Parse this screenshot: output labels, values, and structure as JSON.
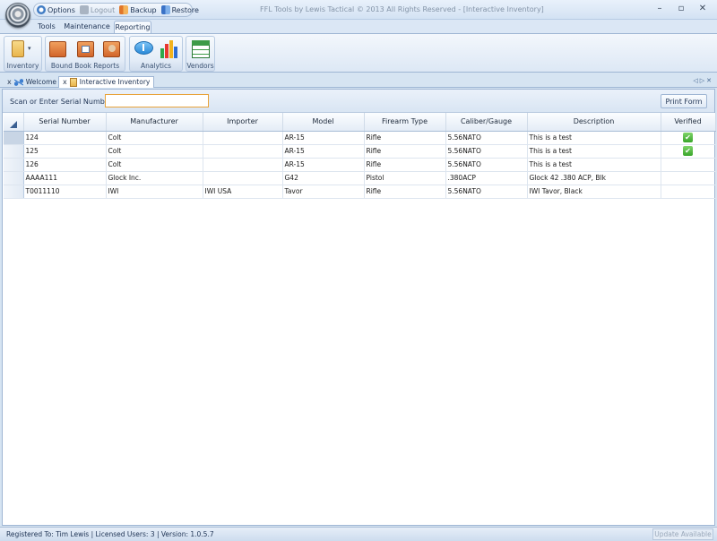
{
  "window": {
    "title": "FFL Tools by Lewis Tactical © 2013 All Rights Reserved - [Interactive Inventory]",
    "controls": {
      "minimize": "–",
      "maximize": "▫",
      "close": "✕"
    }
  },
  "quick_access": [
    {
      "label": "Options",
      "icon": "gear-icon",
      "enabled": true
    },
    {
      "label": "Logout",
      "icon": "logout-icon",
      "enabled": false
    },
    {
      "label": "Backup",
      "icon": "backup-icon",
      "enabled": true
    },
    {
      "label": "Restore",
      "icon": "restore-icon",
      "enabled": true
    }
  ],
  "ribbon_tabs": [
    {
      "label": "Tools",
      "active": false
    },
    {
      "label": "Maintenance",
      "active": false
    },
    {
      "label": "Reporting",
      "active": true
    }
  ],
  "ribbon_groups": [
    {
      "label": "Inventory",
      "icons": [
        "clipboard-icon"
      ]
    },
    {
      "label": "Bound Book Reports",
      "icons": [
        "book-icon",
        "calendar-book-icon",
        "person-book-icon"
      ]
    },
    {
      "label": "Analytics",
      "icons": [
        "speech-bubble-icon",
        "bar-chart-icon"
      ]
    },
    {
      "label": "Vendors",
      "icons": [
        "vendors-table-icon"
      ]
    }
  ],
  "doc_tabs": [
    {
      "label": "Welcome",
      "close": "x",
      "active": false
    },
    {
      "label": "Interactive Inventory",
      "close": "x",
      "active": true
    }
  ],
  "doc_nav": {
    "prev": "◁",
    "next": "▷",
    "close": "✕"
  },
  "scan": {
    "label": "Scan or Enter Serial Number:",
    "value": "",
    "print_label": "Print Form"
  },
  "table": {
    "columns": [
      "Serial Number",
      "Manufacturer",
      "Importer",
      "Model",
      "Firearm Type",
      "Caliber/Gauge",
      "Description",
      "Verified"
    ],
    "rows": [
      {
        "serial": "124",
        "manufacturer": "Colt",
        "importer": "",
        "model": "AR-15",
        "type": "Rifle",
        "caliber": "5.56NATO",
        "description": "This is a test",
        "verified": true
      },
      {
        "serial": "125",
        "manufacturer": "Colt",
        "importer": "",
        "model": "AR-15",
        "type": "Rifle",
        "caliber": "5.56NATO",
        "description": "This is a test",
        "verified": true
      },
      {
        "serial": "126",
        "manufacturer": "Colt",
        "importer": "",
        "model": "AR-15",
        "type": "Rifle",
        "caliber": "5.56NATO",
        "description": "This is a test",
        "verified": false
      },
      {
        "serial": "AAAA111",
        "manufacturer": "Glock Inc.",
        "importer": "",
        "model": "G42",
        "type": "Pistol",
        "caliber": ".380ACP",
        "description": "Glock 42 .380 ACP, Blk",
        "verified": false
      },
      {
        "serial": "T0011110",
        "manufacturer": "IWI",
        "importer": "IWI USA",
        "model": "Tavor",
        "type": "Rifle",
        "caliber": "5.56NATO",
        "description": "IWI Tavor, Black",
        "verified": false
      }
    ],
    "check_icon": "check-icon"
  },
  "status": {
    "text": "Registered To: Tim Lewis | Licensed Users: 3 | Version: 1.0.5.7",
    "update_label": "Update Available"
  }
}
